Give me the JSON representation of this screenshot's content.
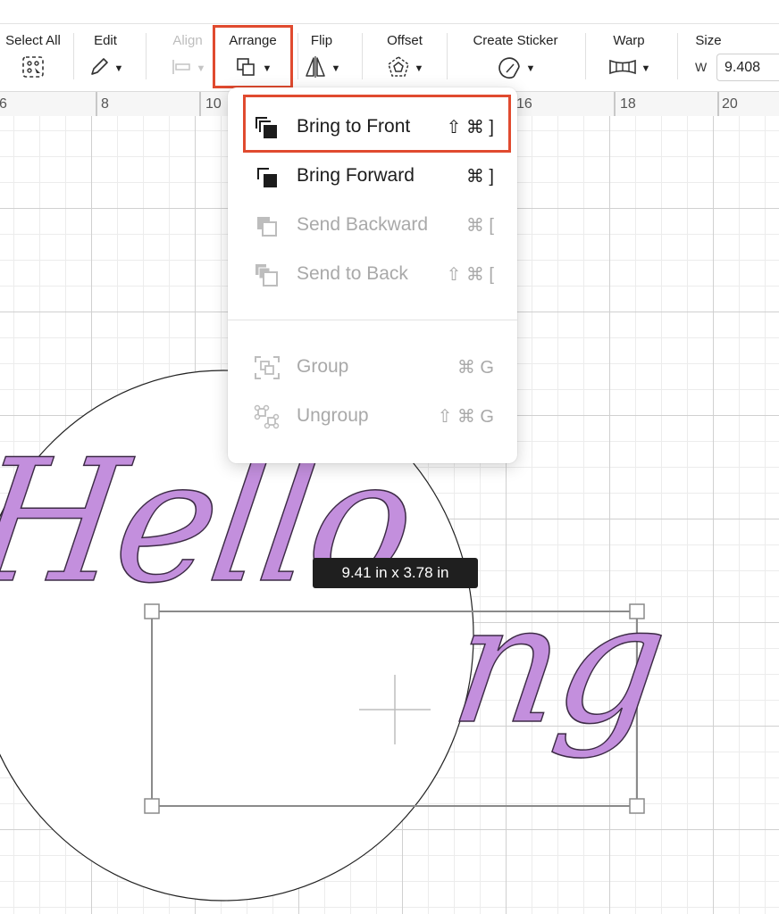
{
  "toolbar": {
    "select_all": "Select All",
    "edit": "Edit",
    "align": "Align",
    "arrange": "Arrange",
    "flip": "Flip",
    "offset": "Offset",
    "create_sticker": "Create Sticker",
    "warp": "Warp",
    "size": "Size",
    "width_label": "W",
    "width_value": "9.408"
  },
  "ruler": {
    "ticks": [
      "6",
      "8",
      "10",
      "16",
      "18",
      "20"
    ]
  },
  "arrange_menu": {
    "items": [
      {
        "label": "Bring to Front",
        "shortcut": "⇧ ⌘ ]",
        "enabled": true,
        "highlighted": true
      },
      {
        "label": "Bring Forward",
        "shortcut": "⌘ ]",
        "enabled": true
      },
      {
        "label": "Send Backward",
        "shortcut": "⌘ [",
        "enabled": false
      },
      {
        "label": "Send to Back",
        "shortcut": "⇧ ⌘ [",
        "enabled": false
      },
      {
        "label": "Group",
        "shortcut": "⌘ G",
        "enabled": false
      },
      {
        "label": "Ungroup",
        "shortcut": "⇧ ⌘ G",
        "enabled": false
      }
    ]
  },
  "canvas": {
    "selection_size": "9.41  in x 3.78  in",
    "text_left": "Hello",
    "text_right": "ng"
  },
  "colors": {
    "highlight": "#e04a2f",
    "text_fill": "#c38fdd",
    "tooltip_bg": "#1f1f1f"
  }
}
